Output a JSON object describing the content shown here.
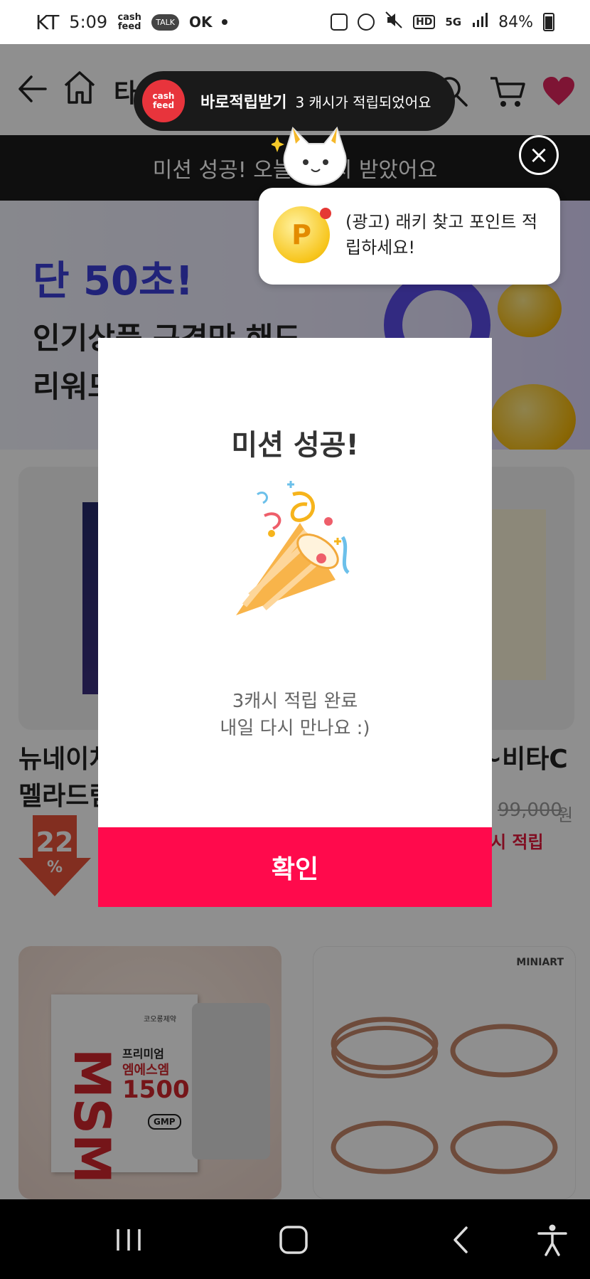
{
  "status_bar": {
    "carrier": "KT",
    "time": "5:09",
    "cashfeed_badge": "cash feed",
    "talk_badge": "TALK",
    "ok_badge": "OK",
    "battery": "84%",
    "hd": "HD",
    "network": "5G"
  },
  "header": {
    "title": "타"
  },
  "toast": {
    "logo": "cash feed",
    "title": "바로적립받기",
    "message": "3 캐시가 적립되었어요"
  },
  "mission_banner": {
    "text": "미션 성공! 오늘 3캐시 받았어요"
  },
  "ad_bubble": {
    "coin_letter": "P",
    "text": "(광고) 래키 찾고 포인트 적립하세요!"
  },
  "hero": {
    "headline": "단 50초!",
    "line1": "인기상품 구경만 해도",
    "line2": "리워드 적립"
  },
  "products": {
    "left": {
      "name_line1": "뉴네이처",
      "name_line2": "멜라드림",
      "discount_value": "22",
      "discount_unit": "%"
    },
    "right": {
      "name": "~비타C",
      "old_price": "99,000",
      "currency": "원",
      "cash_label": "시 적립"
    },
    "msm_card": {
      "brand_small": "코오롱제약",
      "big_text": "MSM",
      "subtitle": "프리미엄",
      "product": "엠에스엠",
      "dosage": "1500",
      "gmp": "GMP"
    },
    "ring_card": {
      "brand": "MINIART"
    }
  },
  "modal": {
    "title": "미션 성공!",
    "line1": "3캐시 적립 완료",
    "line2": "내일 다시 만나요 :)",
    "confirm": "확인"
  },
  "colors": {
    "accent_pink": "#ff0a4c",
    "brand_red": "#e8343c",
    "hero_blue": "#3c3fd8"
  }
}
